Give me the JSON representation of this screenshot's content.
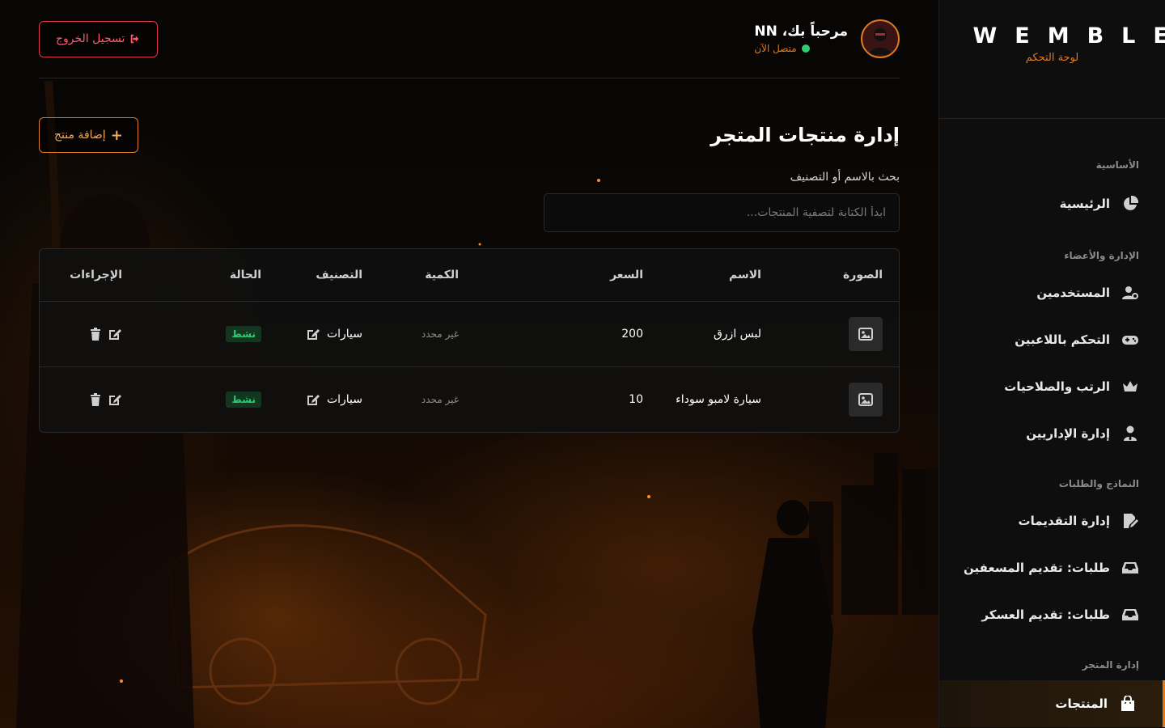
{
  "brand": {
    "name": "WEMBLEY",
    "subtitle": "لوحة التحكم"
  },
  "sidebar": {
    "sections": [
      {
        "title": "الأساسية",
        "items": [
          {
            "label": "الرئيسية",
            "icon": "pie-chart-icon"
          }
        ]
      },
      {
        "title": "الإدارة والأعضاء",
        "items": [
          {
            "label": "المستخدمين",
            "icon": "users-gear-icon"
          },
          {
            "label": "التحكم باللاعبين",
            "icon": "gamepad-icon"
          },
          {
            "label": "الرتب والصلاحيات",
            "icon": "crown-icon"
          },
          {
            "label": "إدارة الإداريين",
            "icon": "user-tie-icon"
          }
        ]
      },
      {
        "title": "النماذج والطلبات",
        "items": [
          {
            "label": "إدارة التقديمات",
            "icon": "file-edit-icon"
          },
          {
            "label": "طلبات: تقديم المسعفين",
            "icon": "inbox-icon"
          },
          {
            "label": "طلبات: تقديم العسكر",
            "icon": "inbox-icon"
          }
        ]
      },
      {
        "title": "إدارة المتجر",
        "items": [
          {
            "label": "المنتجات",
            "icon": "shopping-bag-icon",
            "active": true
          }
        ]
      }
    ]
  },
  "header": {
    "welcome": "مرحباً بك، NN",
    "status": "متصل الآن",
    "logout_label": "تسجيل الخروج"
  },
  "page": {
    "title": "إدارة منتجات المتجر",
    "add_label": "إضافة منتج",
    "search_label": "بحث بالاسم أو التصنيف",
    "search_placeholder": "ابدأ الكتابة لتصفية المنتجات..."
  },
  "table": {
    "headers": [
      "الصورة",
      "الاسم",
      "السعر",
      "الكمية",
      "التصنيف",
      "الحالة",
      "الإجراءات"
    ],
    "rows": [
      {
        "name": "لبس ازرق",
        "price": "200",
        "qty": "غير محدد",
        "category": "سيارات",
        "status": "نشط"
      },
      {
        "name": "سيارة لامبو سوداء",
        "price": "10",
        "qty": "غير محدد",
        "category": "سيارات",
        "status": "نشط"
      }
    ]
  },
  "colors": {
    "accent": "#e07a1f",
    "danger": "#e0334a",
    "success": "#2ecc71"
  }
}
